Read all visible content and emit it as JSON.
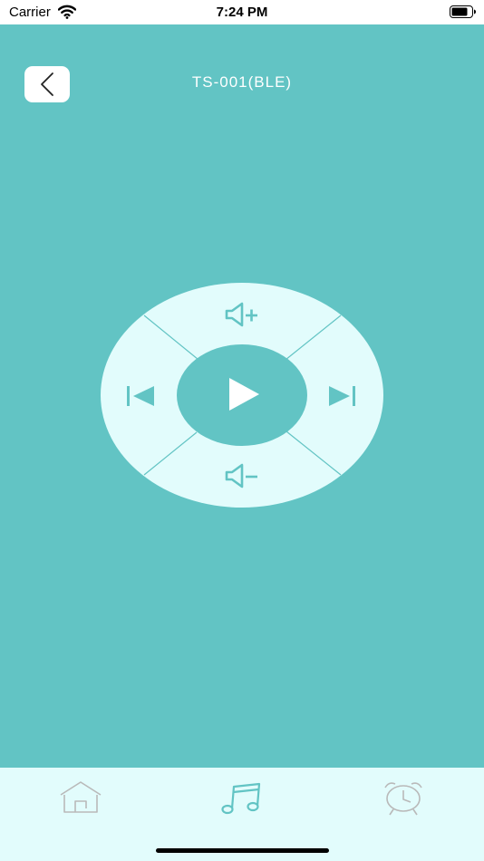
{
  "status_bar": {
    "carrier": "Carrier",
    "time": "7:24 PM"
  },
  "header": {
    "title": "TS-001(BLE)",
    "back_icon": "chevron-left-icon"
  },
  "remote": {
    "buttons": [
      {
        "name": "volume-up",
        "icon": "speaker-plus-icon"
      },
      {
        "name": "previous",
        "icon": "skip-previous-icon"
      },
      {
        "name": "play",
        "icon": "play-icon"
      },
      {
        "name": "next",
        "icon": "skip-next-icon"
      },
      {
        "name": "volume-down",
        "icon": "speaker-minus-icon"
      }
    ]
  },
  "tabbar": {
    "tabs": [
      {
        "name": "home",
        "icon": "home-icon",
        "selected": false
      },
      {
        "name": "music",
        "icon": "music-note-icon",
        "selected": true
      },
      {
        "name": "alarm",
        "icon": "alarm-clock-icon",
        "selected": false
      }
    ]
  },
  "colors": {
    "background": "#62c4c4",
    "remote_face": "#e2fcfc",
    "center_button": "#62c4c4",
    "icon": "#62c4c4",
    "tabbar_background": "#e2fcfc",
    "tab_inactive": "#b9b9b9",
    "tab_active": "#62c4c4",
    "title_text": "#ffffff"
  }
}
